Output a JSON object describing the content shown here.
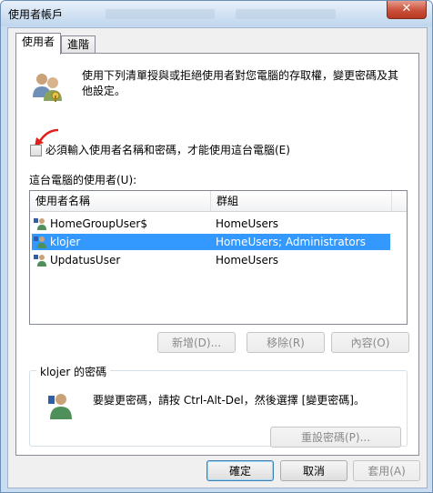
{
  "window": {
    "title": "使用者帳戶",
    "close_glyph": "✕"
  },
  "tabs": [
    {
      "label": "使用者",
      "active": true
    },
    {
      "label": "進階",
      "active": false
    }
  ],
  "description": "使用下列清單授與或拒絕使用者對您電腦的存取權，變更密碼及其他設定。",
  "require_login": {
    "label": "必須輸入使用者名稱和密碼，才能使用這台電腦(E)",
    "checked": false
  },
  "users_section": {
    "label": "這台電腦的使用者(U):",
    "columns": [
      "使用者名稱",
      "群組"
    ],
    "rows": [
      {
        "name": "HomeGroupUser$",
        "group": "HomeUsers",
        "selected": false
      },
      {
        "name": "klojer",
        "group": "HomeUsers; Administrators",
        "selected": true
      },
      {
        "name": "UpdatusUser",
        "group": "HomeUsers",
        "selected": false
      }
    ]
  },
  "user_buttons": {
    "add": "新增(D)...",
    "remove": "移除(R)",
    "properties": "內容(O)"
  },
  "password_group": {
    "title": "klojer 的密碼",
    "text": "要變更密碼，請按 Ctrl-Alt-Del，然後選擇 [變更密碼]。",
    "reset_button": "重設密碼(P)..."
  },
  "dialog_buttons": {
    "ok": "確定",
    "cancel": "取消",
    "apply": "套用(A)"
  },
  "colors": {
    "selection": "#3399ff",
    "close": "#c9503a",
    "annotation_arrow": "#e0201c"
  },
  "icons": {
    "users": "users-icon",
    "user_row": "user-icon",
    "password": "user-key-icon",
    "annotation": "red-arrow-icon"
  }
}
